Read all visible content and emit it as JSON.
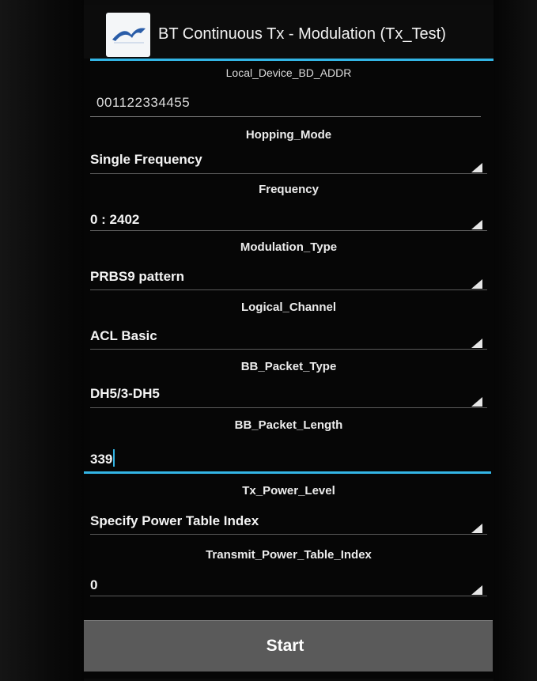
{
  "app": {
    "title": "BT Continuous Tx - Modulation (Tx_Test)",
    "accent_color": "#33b5e5",
    "icon": "app-logo-icon"
  },
  "fields": {
    "local_bd_addr": {
      "label": "Local_Device_BD_ADDR",
      "value": "001122334455"
    },
    "hopping_mode": {
      "label": "Hopping_Mode",
      "value": "Single Frequency"
    },
    "frequency": {
      "label": "Frequency",
      "value": "0 : 2402"
    },
    "modulation_type": {
      "label": "Modulation_Type",
      "value": "PRBS9 pattern"
    },
    "logical_channel": {
      "label": "Logical_Channel",
      "value": "ACL Basic"
    },
    "bb_packet_type": {
      "label": "BB_Packet_Type",
      "value": "DH5/3-DH5"
    },
    "bb_packet_length": {
      "label": "BB_Packet_Length",
      "value": "339"
    },
    "tx_power_level": {
      "label": "Tx_Power_Level",
      "value": "Specify Power Table Index"
    },
    "transmit_power_table_index": {
      "label": "Transmit_Power_Table_Index",
      "value": "0"
    }
  },
  "actions": {
    "start_label": "Start"
  }
}
